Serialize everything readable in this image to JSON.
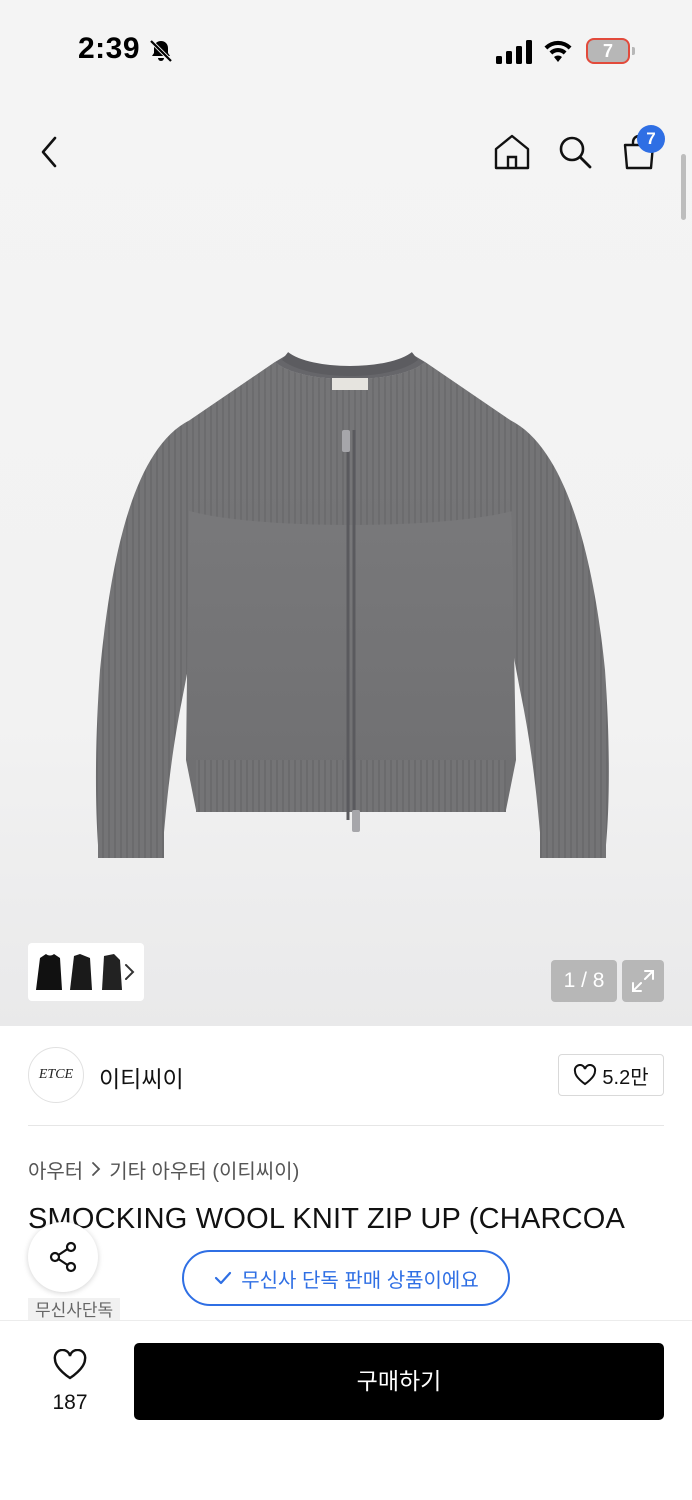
{
  "status_bar": {
    "time": "2:39",
    "battery_level": "7"
  },
  "nav": {
    "cart_count": "7"
  },
  "gallery": {
    "counter": "1 / 8",
    "current_page": 1,
    "total_pages": 8,
    "image_icon": "charcoal-zip-up-knit-cardigan"
  },
  "brand": {
    "logo_text": "ETCE",
    "name": "이티씨이",
    "likes": "5.2만"
  },
  "breadcrumb": {
    "level1": "아우터",
    "level2": "기타 아우터 (이티씨이)"
  },
  "product": {
    "title": "SMOCKING WOOL KNIT ZIP UP (CHARCOA",
    "exclusive_banner": "무신사 단독 판매 상품이에요",
    "tag": "무신사단독"
  },
  "bottom_bar": {
    "wish_count": "187",
    "buy_label": "구매하기"
  },
  "colors": {
    "accent_blue": "#2f6fe4",
    "buy_button": "#000000",
    "battery_warning": "#e24a3b"
  }
}
